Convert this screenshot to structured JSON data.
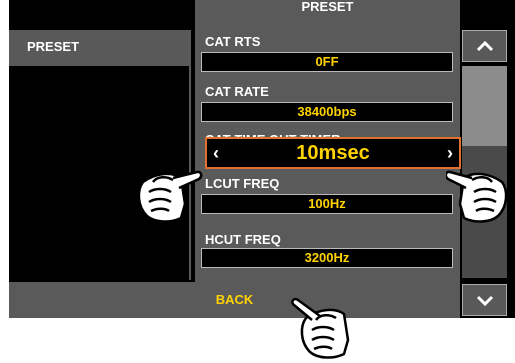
{
  "header": {
    "title": "PRESET"
  },
  "left_panel": {
    "title": "PRESET"
  },
  "items": [
    {
      "label": "CAT RTS",
      "value": "0FF"
    },
    {
      "label": "CAT RATE",
      "value": "38400bps"
    },
    {
      "label": "CAT TIME OUT TIMER",
      "value": "10msec"
    },
    {
      "label": "LCUT FREQ",
      "value": "100Hz"
    },
    {
      "label": "HCUT FREQ",
      "value": "3200Hz"
    }
  ],
  "arrows": {
    "left": "‹",
    "right": "›",
    "up": "︿",
    "down": "﹀"
  },
  "footer": {
    "back_label": "BACK"
  }
}
